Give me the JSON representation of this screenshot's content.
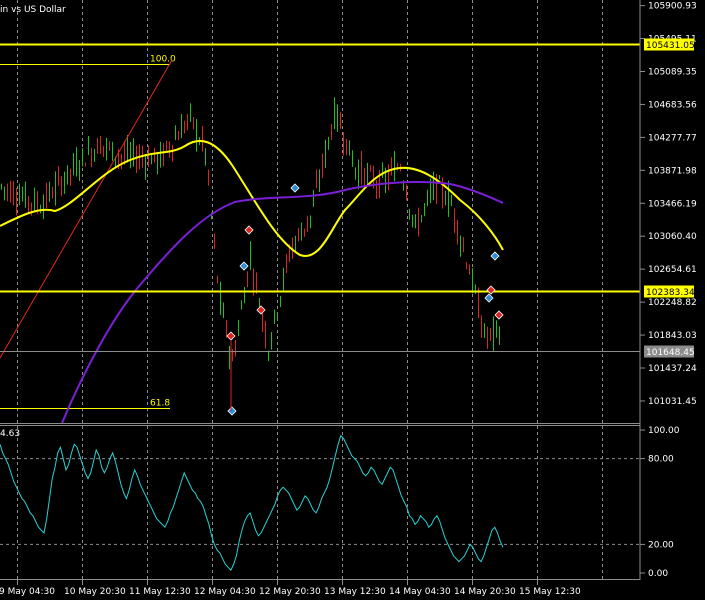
{
  "chart_data": [
    {
      "type": "candlestick",
      "title": "in vs US Dollar",
      "price_ticks": [
        105900.93,
        105495.11,
        105089.35,
        104683.56,
        104277.77,
        103871.98,
        103466.19,
        103060.4,
        102654.61,
        102248.82,
        101843.03,
        101437.24,
        101031.45
      ],
      "price_range": [
        100760,
        105970
      ],
      "horizontal_lines": [
        {
          "label": "105431.05",
          "price": 105431.05,
          "color": "#ffff00"
        },
        {
          "label": "102383.34",
          "price": 102383.34,
          "color": "#ffff00"
        },
        {
          "label": "101648.45",
          "price": 101648.45,
          "color": "#8c8c8c"
        }
      ],
      "fibo_levels": [
        {
          "label": "100.0",
          "price": 105180
        },
        {
          "label": "61.8",
          "price": 100945
        }
      ],
      "x_labels": [
        "9 May 04:30",
        "10 May 20:30",
        "11 May 12:30",
        "12 May 04:30",
        "12 May 20:30",
        "13 May 12:30",
        "14 May 04:30",
        "14 May 20:30",
        "15 May 12:30"
      ],
      "series": [
        {
          "name": "",
          "color": "#ffff00"
        },
        {
          "name": "",
          "color": "#7a1fd6"
        }
      ]
    },
    {
      "type": "line",
      "title": "4.63",
      "y_ticks": [
        "100.00",
        "80.00",
        "20.00",
        "0.00"
      ],
      "ylim": [
        0,
        100
      ],
      "levels": [
        80,
        20
      ],
      "series": [
        {
          "name": "",
          "color": "#27d2d2",
          "values": [
            90,
            84,
            80,
            76,
            70,
            64,
            60,
            56,
            52,
            50,
            46,
            42,
            40,
            36,
            32,
            30,
            28,
            38,
            52,
            66,
            74,
            84,
            88,
            80,
            72,
            76,
            84,
            90,
            88,
            82,
            76,
            70,
            66,
            70,
            78,
            86,
            82,
            74,
            70,
            74,
            80,
            84,
            78,
            70,
            62,
            56,
            52,
            58,
            66,
            72,
            68,
            62,
            58,
            54,
            50,
            46,
            42,
            38,
            36,
            34,
            32,
            36,
            42,
            46,
            52,
            58,
            64,
            70,
            66,
            62,
            58,
            56,
            52,
            50,
            46,
            40,
            34,
            26,
            20,
            16,
            14,
            10,
            6,
            4,
            2,
            6,
            12,
            22,
            30,
            36,
            40,
            42,
            36,
            30,
            26,
            28,
            32,
            36,
            40,
            44,
            48,
            54,
            58,
            60,
            58,
            56,
            52,
            48,
            44,
            46,
            50,
            54,
            52,
            48,
            44,
            42,
            46,
            52,
            56,
            60,
            66,
            74,
            82,
            90,
            96,
            94,
            90,
            86,
            82,
            80,
            78,
            74,
            70,
            68,
            70,
            74,
            72,
            68,
            64,
            62,
            66,
            70,
            74,
            72,
            66,
            60,
            54,
            50,
            46,
            40,
            38,
            34,
            36,
            40,
            38,
            36,
            32,
            34,
            38,
            40,
            36,
            30,
            24,
            20,
            16,
            12,
            10,
            8,
            10,
            12,
            16,
            20,
            18,
            14,
            10,
            8,
            12,
            18,
            24,
            30,
            32,
            28,
            22,
            18
          ]
        }
      ]
    }
  ]
}
